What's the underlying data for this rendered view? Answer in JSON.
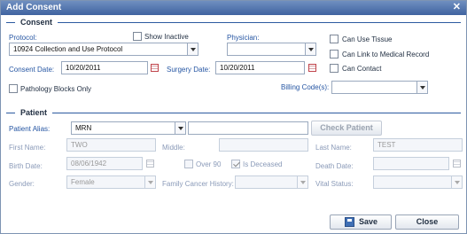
{
  "window": {
    "title": "Add Consent",
    "close_glyph": "✕"
  },
  "consent": {
    "section_title": "Consent",
    "protocol_label": "Protocol:",
    "protocol_value": "10924 Collection and Use Protocol",
    "show_inactive_label": "Show Inactive",
    "physician_label": "Physician:",
    "physician_value": "",
    "can_use_tissue_label": "Can Use Tissue",
    "can_link_label": "Can Link to Medical Record",
    "can_contact_label": "Can Contact",
    "consent_date_label": "Consent Date:",
    "consent_date_value": "10/20/2011",
    "surgery_date_label": "Surgery Date:",
    "surgery_date_value": "10/20/2011",
    "pathology_label": "Pathology Blocks Only",
    "billing_label": "Billing Code(s):",
    "billing_value": ""
  },
  "patient": {
    "section_title": "Patient",
    "alias_label": "Patient Alias:",
    "alias_type_value": "MRN",
    "alias_value": "",
    "check_patient_label": "Check Patient",
    "first_name_label": "First Name:",
    "first_name_value": "TWO",
    "middle_label": "Middle:",
    "middle_value": "",
    "last_name_label": "Last Name:",
    "last_name_value": "TEST",
    "birth_date_label": "Birth Date:",
    "birth_date_value": "08/06/1942",
    "over90_label": "Over 90",
    "over90_checked": false,
    "deceased_label": "Is Deceased",
    "deceased_checked": true,
    "death_date_label": "Death Date:",
    "death_date_value": "",
    "gender_label": "Gender:",
    "gender_value": "Female",
    "family_history_label": "Family Cancer History:",
    "family_history_value": "",
    "vital_status_label": "Vital Status:",
    "vital_status_value": ""
  },
  "footer": {
    "save_label": "Save",
    "close_label": "Close"
  },
  "colors": {
    "accent": "#2c5aa0",
    "label": "#2656a3",
    "disabled_label": "#8a9ab8",
    "title_bar": "#4a6aa8"
  }
}
